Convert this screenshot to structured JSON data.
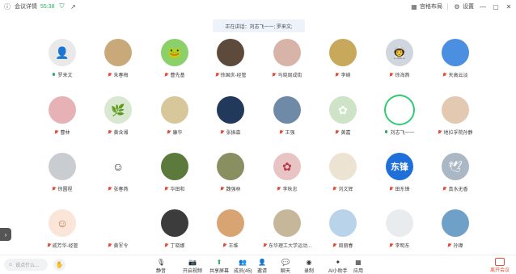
{
  "topbar": {
    "meeting_info": "会议详情",
    "duration": "55:38",
    "layout_label": "宫格布局",
    "settings_label": "设置",
    "icons": [
      "info-icon",
      "shield-icon",
      "external-link-icon",
      "grid-layout-icon",
      "gear-icon",
      "minimize-icon",
      "maximize-icon",
      "close-icon"
    ]
  },
  "speaking": {
    "text": "正在讲话：刘志飞一一; 罗来文;"
  },
  "participants": [
    {
      "name": "罗来文",
      "mic": "on"
    },
    {
      "name": "朱春梅",
      "mic": "off"
    },
    {
      "name": "曹先基",
      "mic": "off"
    },
    {
      "name": "徐国庆-经管",
      "mic": "off"
    },
    {
      "name": "马晓周成街",
      "mic": "off"
    },
    {
      "name": "李峭",
      "mic": "off"
    },
    {
      "name": "徐海燕",
      "mic": "off"
    },
    {
      "name": "天高云淡",
      "mic": "off"
    },
    {
      "name": "曹林",
      "mic": "off"
    },
    {
      "name": "黄含湘",
      "mic": "off"
    },
    {
      "name": "康华",
      "mic": "off"
    },
    {
      "name": "张振森",
      "mic": "off"
    },
    {
      "name": "王强",
      "mic": "off"
    },
    {
      "name": "黄嘉",
      "mic": "off"
    },
    {
      "name": "刘志飞一一",
      "mic": "on"
    },
    {
      "name": "地拉孚院孙静",
      "mic": "off"
    },
    {
      "name": "徐圆程",
      "mic": "off"
    },
    {
      "name": "张春燕",
      "mic": "off"
    },
    {
      "name": "华田和",
      "mic": "off"
    },
    {
      "name": "魏强林",
      "mic": "off"
    },
    {
      "name": "李秋忠",
      "mic": "off"
    },
    {
      "name": "刘文辉",
      "mic": "off"
    },
    {
      "name": "田东锋",
      "mic": "off"
    },
    {
      "name": "真水无香",
      "mic": "off"
    },
    {
      "name": "戚芳华-经管",
      "mic": "off"
    },
    {
      "name": "黄军令",
      "mic": "off"
    },
    {
      "name": "丁晓娜",
      "mic": "off"
    },
    {
      "name": "王维",
      "mic": "off"
    },
    {
      "name": "东华理工大学运动...",
      "mic": "off"
    },
    {
      "name": "周丽春",
      "mic": "off"
    },
    {
      "name": "李明东",
      "mic": "off"
    },
    {
      "name": "孙瑋",
      "mic": "off"
    }
  ],
  "avatars": [
    {
      "bg": "#e9e9e9",
      "fg": "#bdbdbd",
      "label": "",
      "icon": "person-icon"
    },
    {
      "bg": "#c9a97a",
      "fg": "#fff",
      "label": "",
      "icon": "photo-icon"
    },
    {
      "bg": "#8bd06a",
      "fg": "#2d6b1c",
      "label": "",
      "icon": "frog-icon"
    },
    {
      "bg": "#5d4a3a",
      "fg": "#fff",
      "label": "",
      "icon": "photo-icon"
    },
    {
      "bg": "#d7b4a7",
      "fg": "#fff",
      "label": "",
      "icon": "photo-icon"
    },
    {
      "bg": "#c8a85a",
      "fg": "#fff",
      "label": "",
      "icon": "photo-icon"
    },
    {
      "bg": "#cfd6de",
      "fg": "#333",
      "label": "",
      "icon": "astronaut-icon"
    },
    {
      "bg": "#4a8fe0",
      "fg": "#fff",
      "label": "",
      "icon": "photo-icon"
    },
    {
      "bg": "#e7b2b6",
      "fg": "#fff",
      "label": "",
      "icon": "photo-icon"
    },
    {
      "bg": "#d9e8d0",
      "fg": "#3e8b2d",
      "label": "",
      "icon": "plant-icon"
    },
    {
      "bg": "#d8c79a",
      "fg": "#fff",
      "label": "",
      "icon": "photo-icon"
    },
    {
      "bg": "#213a5c",
      "fg": "#fff",
      "label": "",
      "icon": "photo-icon"
    },
    {
      "bg": "#6e8aa6",
      "fg": "#fff",
      "label": "",
      "icon": "photo-icon"
    },
    {
      "bg": "#cfe3c8",
      "fg": "#fff",
      "label": "",
      "icon": "flower-icon"
    },
    {
      "bg": "#ffffff",
      "fg": "#777",
      "label": "",
      "icon": "photo-icon"
    },
    {
      "bg": "#e3c9b2",
      "fg": "#fff",
      "label": "",
      "icon": "photo-icon"
    },
    {
      "bg": "#c9cdd2",
      "fg": "#fff",
      "label": "",
      "icon": "photo-icon"
    },
    {
      "bg": "#ffffff",
      "fg": "#333",
      "label": "",
      "icon": "cartoon-icon"
    },
    {
      "bg": "#5b7a3c",
      "fg": "#fff",
      "label": "",
      "icon": "photo-icon"
    },
    {
      "bg": "#8a8f62",
      "fg": "#fff",
      "label": "",
      "icon": "photo-icon"
    },
    {
      "bg": "#e8c4c4",
      "fg": "#b4394a",
      "label": "",
      "icon": "flower-icon"
    },
    {
      "bg": "#ece3d3",
      "fg": "#999",
      "label": "",
      "icon": "photo-icon"
    },
    {
      "bg": "#1e6fd9",
      "fg": "#fff",
      "label": "东锋",
      "icon": "text-avatar-icon"
    },
    {
      "bg": "#aab7c4",
      "fg": "#fff",
      "label": "",
      "icon": "bird-icon"
    },
    {
      "bg": "#fbe4d8",
      "fg": "#b57a4a",
      "label": "",
      "icon": "cartoon-icon"
    },
    {
      "bg": "#ffffff",
      "fg": "#333",
      "label": "",
      "icon": "photo-icon"
    },
    {
      "bg": "#3c3c3c",
      "fg": "#fff",
      "label": "",
      "icon": "photo-icon"
    },
    {
      "bg": "#d8a472",
      "fg": "#fff",
      "label": "",
      "icon": "photo-icon"
    },
    {
      "bg": "#c7b79a",
      "fg": "#fff",
      "label": "",
      "icon": "photo-icon"
    },
    {
      "bg": "#b9d4ea",
      "fg": "#fff",
      "label": "",
      "icon": "photo-icon"
    },
    {
      "bg": "#e9ecef",
      "fg": "#333",
      "label": "",
      "icon": "photo-icon"
    },
    {
      "bg": "#6fa0c7",
      "fg": "#fff",
      "label": "",
      "icon": "photo-icon"
    }
  ],
  "active_index": 14,
  "toolbar": {
    "chat_placeholder": "说点什么...",
    "items": [
      {
        "label": "静音",
        "icon": "microphone-icon"
      },
      {
        "label": "开启视频",
        "icon": "camera-icon"
      },
      {
        "label": "共享屏幕",
        "icon": "share-screen-icon"
      },
      {
        "label": "成员(45)",
        "icon": "members-icon"
      },
      {
        "label": "邀请",
        "icon": "invite-icon"
      },
      {
        "label": "聊天",
        "icon": "chat-icon"
      },
      {
        "label": "录制",
        "icon": "record-icon"
      },
      {
        "label": "AI小助手",
        "icon": "ai-assistant-icon"
      },
      {
        "label": "应用",
        "icon": "apps-icon"
      }
    ],
    "leave_label": "离开会议"
  }
}
